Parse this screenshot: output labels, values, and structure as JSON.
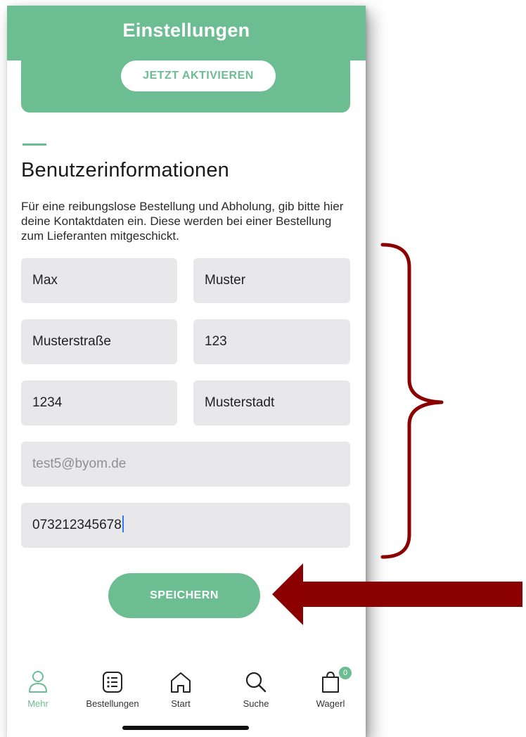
{
  "header": {
    "title": "Einstellungen"
  },
  "promo": {
    "activate_label": "JETZT AKTIVIEREN"
  },
  "section": {
    "title": "Benutzerinformationen",
    "description": "Für eine reibungslose Bestellung und Abholung, gib bitte hier deine Kontaktdaten ein. Diese werden bei einer Bestellung zum Lieferanten mitgeschickt."
  },
  "form": {
    "first_name": "Max",
    "last_name": "Muster",
    "street": "Musterstraße",
    "house_number": "123",
    "zip": "1234",
    "city": "Musterstadt",
    "email": "test5@byom.de",
    "phone": "073212345678"
  },
  "save_label": "SPEICHERN",
  "tabbar": {
    "items": [
      {
        "label": "Mehr",
        "icon": "person-icon",
        "active": true
      },
      {
        "label": "Bestellungen",
        "icon": "list-icon",
        "active": false
      },
      {
        "label": "Start",
        "icon": "home-icon",
        "active": false
      },
      {
        "label": "Suche",
        "icon": "search-icon",
        "active": false
      },
      {
        "label": "Wagerl",
        "icon": "bag-icon",
        "active": false
      }
    ],
    "cart_count": "0"
  },
  "colors": {
    "accent": "#6dbd93",
    "annotation": "#8b0000",
    "field_bg": "#e8e8ea"
  }
}
